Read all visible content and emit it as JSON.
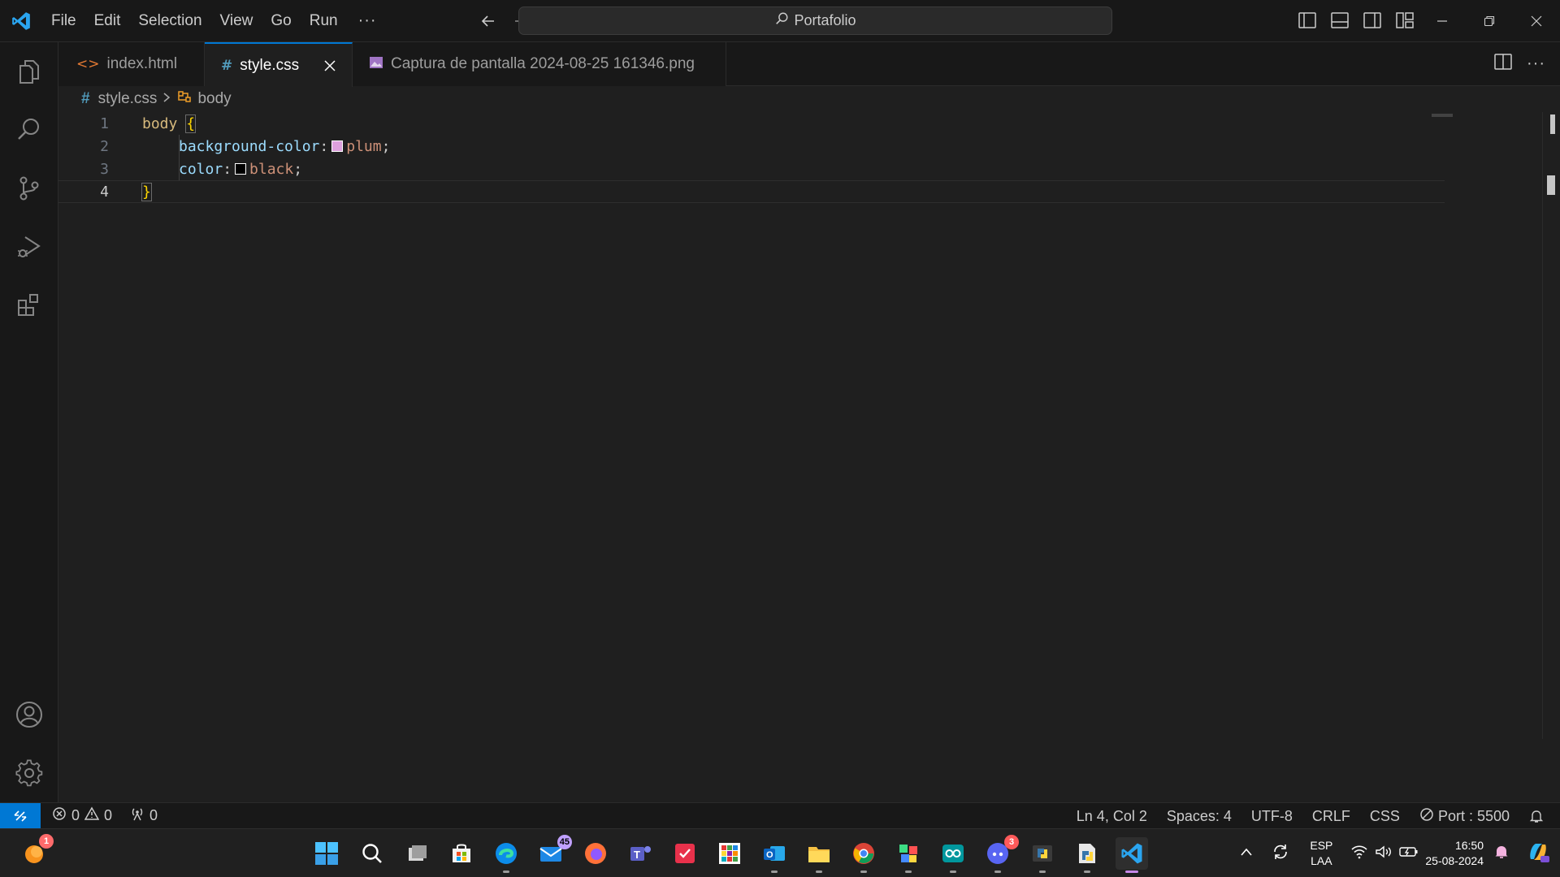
{
  "titlebar": {
    "menu": [
      "File",
      "Edit",
      "Selection",
      "View",
      "Go",
      "Run"
    ],
    "more": "···",
    "command_center": "Portafolio"
  },
  "tabs": [
    {
      "icon": "html-file-icon",
      "label": "index.html",
      "active": false
    },
    {
      "icon": "css-file-icon",
      "label": "style.css",
      "active": true
    },
    {
      "icon": "image-file-icon",
      "label": "Captura de pantalla 2024-08-25 161346.png",
      "active": false
    }
  ],
  "breadcrumb": {
    "file": "style.css",
    "symbol": "body"
  },
  "editor": {
    "line_numbers": [
      "1",
      "2",
      "3",
      "4"
    ],
    "selector": "body",
    "open_brace": "{",
    "close_brace": "}",
    "prop1": "background-color",
    "val1": "plum",
    "val1_color": "#dda0dd",
    "prop2": "color",
    "val2": "black",
    "val2_color": "#000000"
  },
  "statusbar": {
    "errors": "0",
    "warnings": "0",
    "ports": "0",
    "position": "Ln 4, Col 2",
    "spaces": "Spaces: 4",
    "encoding": "UTF-8",
    "eol": "CRLF",
    "language": "CSS",
    "live_server": "Port : 5500"
  },
  "taskbar": {
    "weather_badge": "1",
    "mail_badge": "45",
    "discord_badge": "3",
    "lang_top": "ESP",
    "lang_bottom": "LAA",
    "time": "16:50",
    "date": "25-08-2024"
  },
  "colors": {
    "accent": "#0078d4",
    "background": "#1f1f1f",
    "chrome": "#181818"
  }
}
